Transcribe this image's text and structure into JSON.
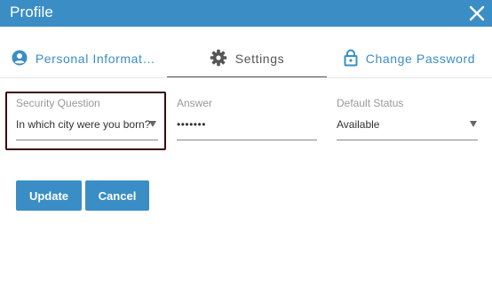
{
  "dialog": {
    "title": "Profile"
  },
  "tabs": [
    {
      "label": "Personal Informat…",
      "icon": "user-circle-icon",
      "active": false
    },
    {
      "label": "Settings",
      "icon": "gear-icon",
      "active": true
    },
    {
      "label": "Change Password",
      "icon": "lock-icon",
      "active": false
    }
  ],
  "form": {
    "security_question": {
      "label": "Security Question",
      "value": "In which city were you born?"
    },
    "answer": {
      "label": "Answer",
      "value": "•••••••"
    },
    "default_status": {
      "label": "Default Status",
      "value": "Available"
    }
  },
  "buttons": {
    "update_label": "Update",
    "cancel_label": "Cancel"
  },
  "colors": {
    "accent": "#3a8ec5",
    "focus_border": "#3b0606"
  }
}
